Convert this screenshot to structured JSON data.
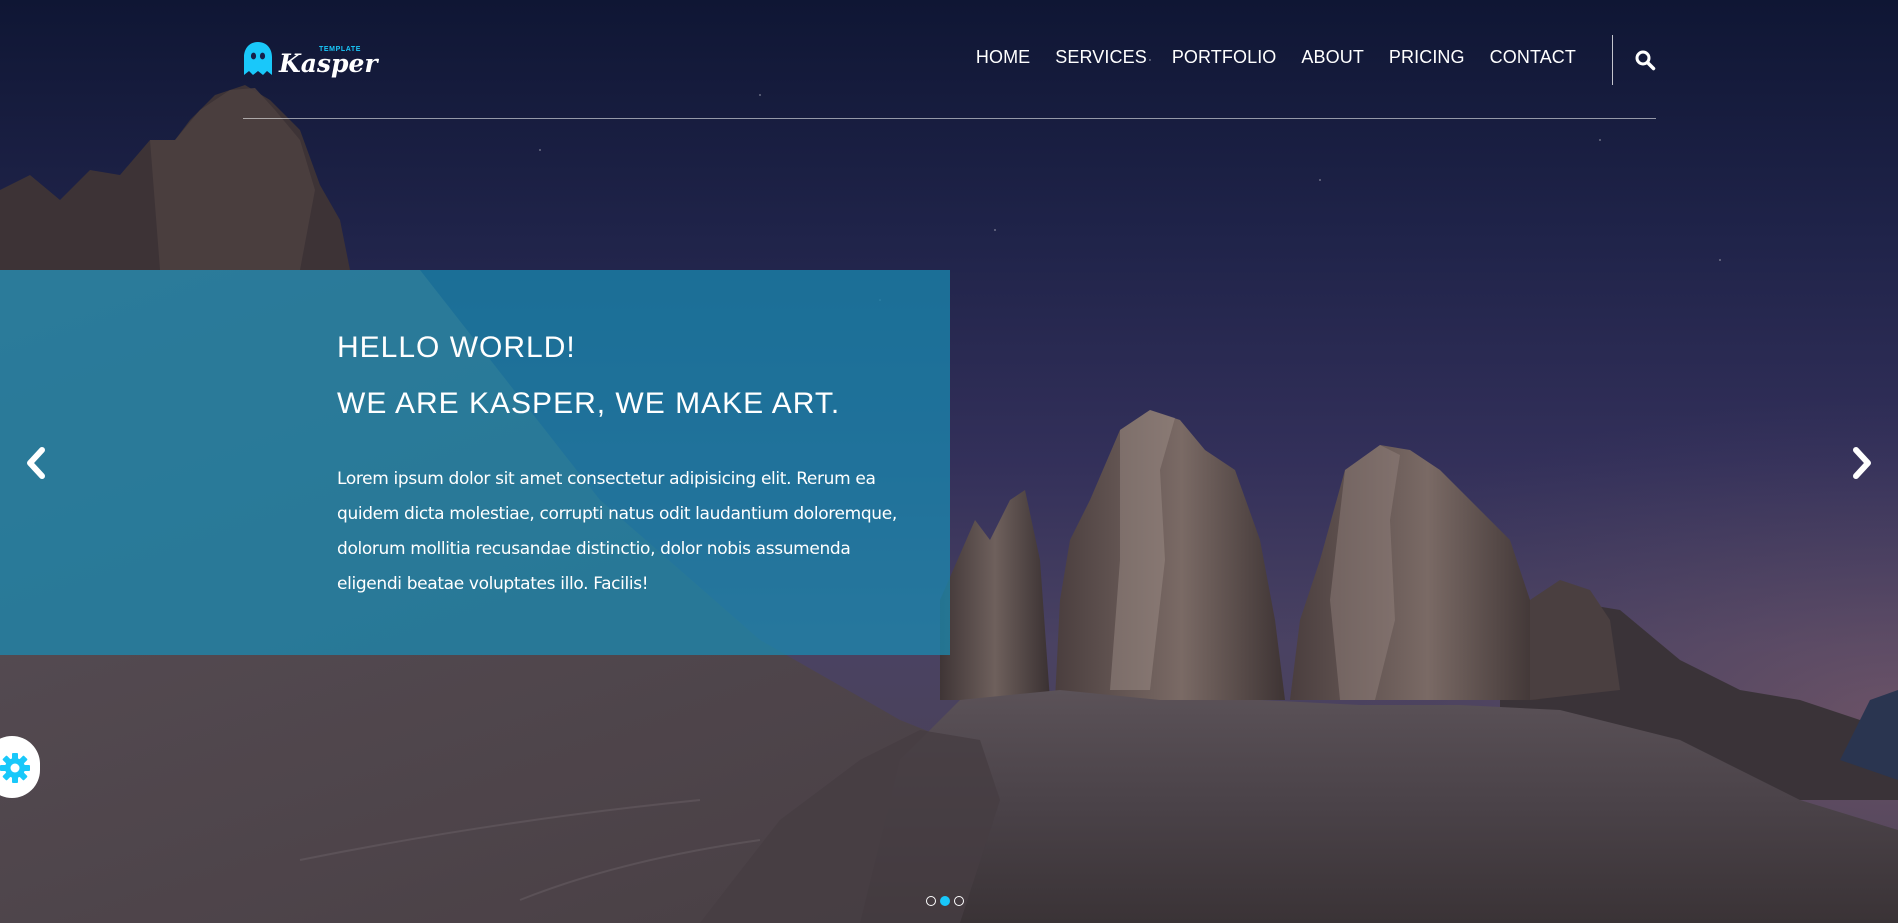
{
  "brand": {
    "name": "Kasper",
    "tag": "TEMPLATE",
    "accent_color": "#19c8fa",
    "logo_icon": "ghost-icon"
  },
  "nav": {
    "items": [
      {
        "label": "HOME"
      },
      {
        "label": "SERVICES"
      },
      {
        "label": "PORTFOLIO"
      },
      {
        "label": "ABOUT"
      },
      {
        "label": "PRICING"
      },
      {
        "label": "CONTACT"
      }
    ],
    "search_icon": "search-icon"
  },
  "hero": {
    "heading_1": "HELLO WORLD!",
    "heading_2": "WE ARE KASPER, WE MAKE ART.",
    "description": "Lorem ipsum dolor sit amet consectetur adipisicing elit. Rerum ea quidem dicta molestiae, corrupti natus odit laudantium doloremque, dolorum mollitia recusandae distinctio, dolor nobis assumenda eligendi beatae voluptates illo. Facilis!",
    "box_color": "#1e8cb4",
    "prev_icon": "chevron-left-icon",
    "next_icon": "chevron-right-icon"
  },
  "slider": {
    "total_slides": 3,
    "active_slide": 2
  },
  "settings": {
    "icon": "gear-icon"
  }
}
